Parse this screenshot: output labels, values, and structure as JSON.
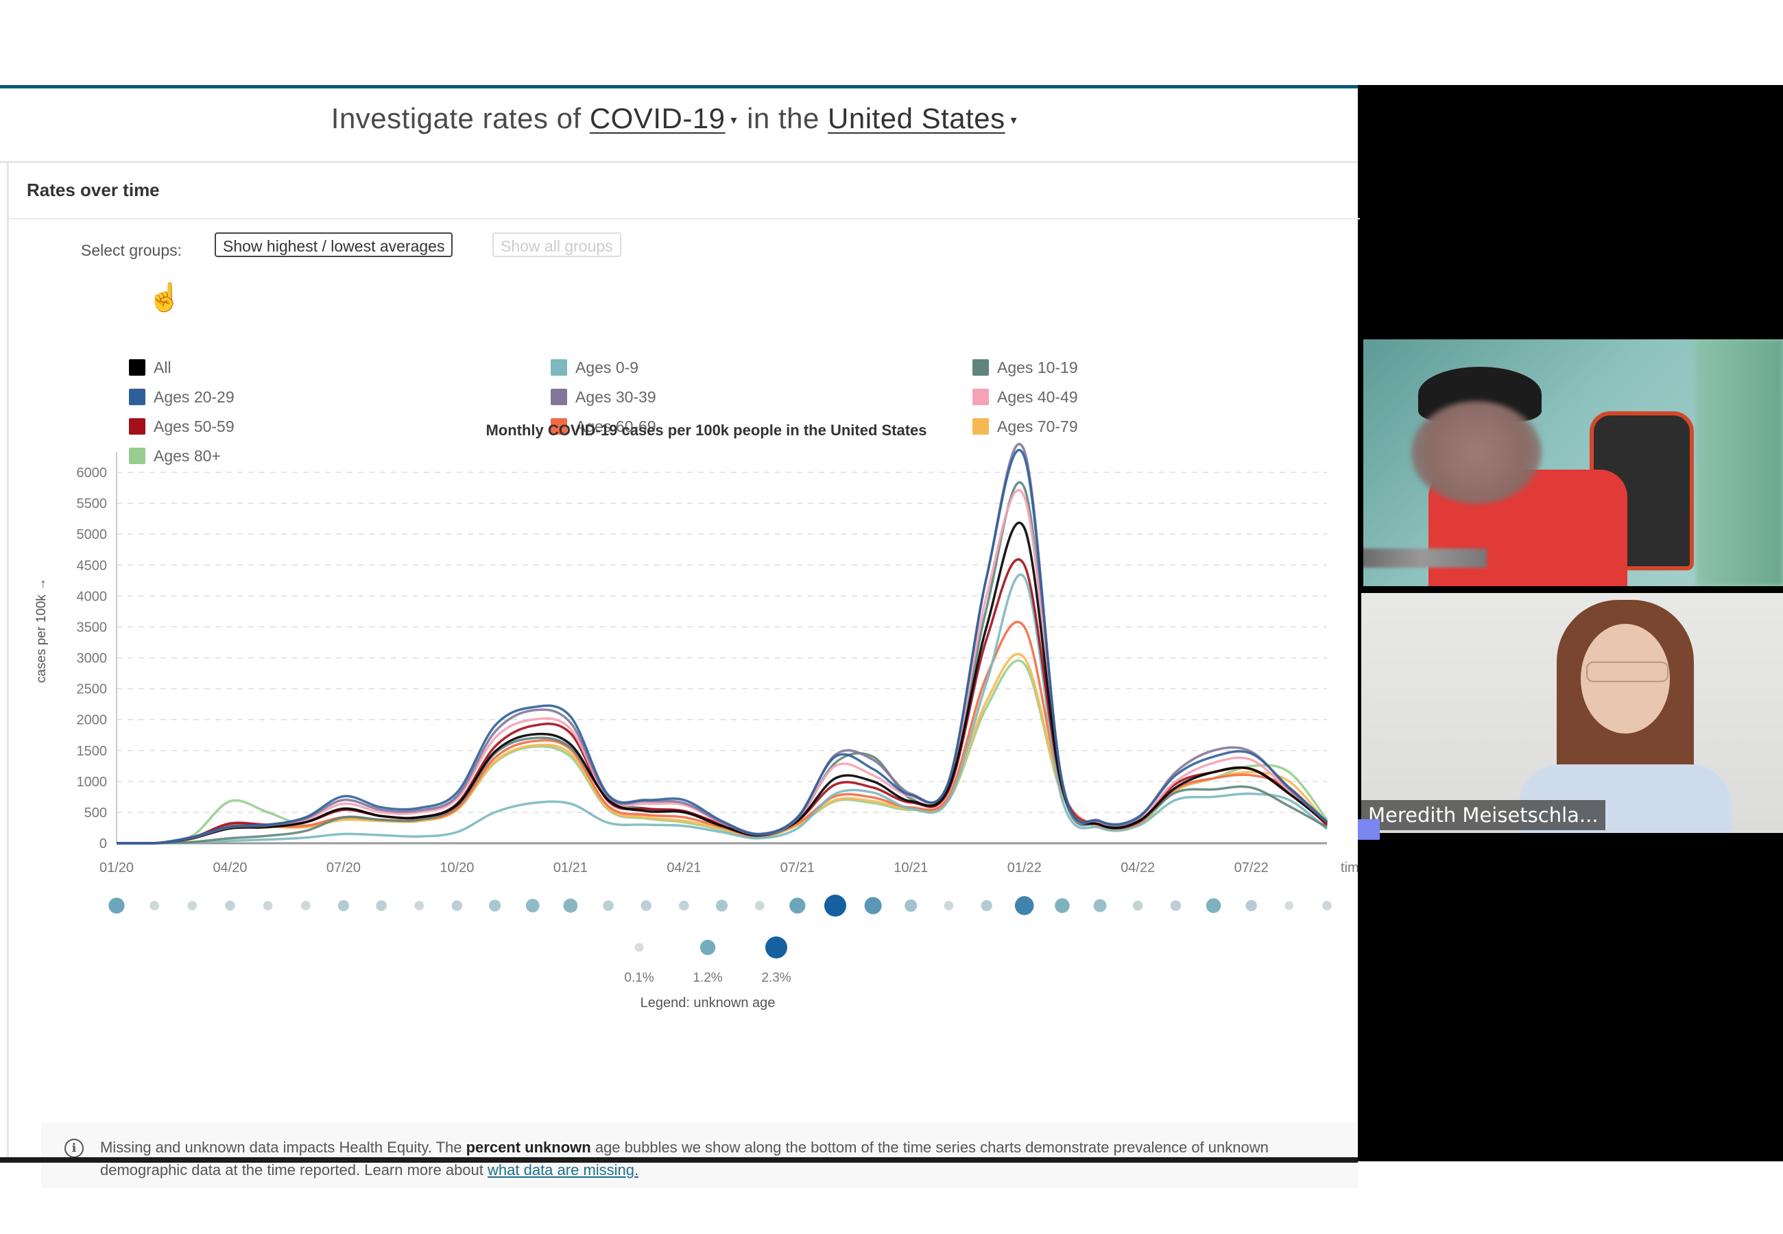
{
  "header": {
    "prefix": "Investigate rates of",
    "condition": "COVID-19",
    "middle": "in the",
    "location": "United States",
    "caret": "▾"
  },
  "card": {
    "title": "Rates over time",
    "select_groups_label": "Select groups:",
    "buttons": {
      "highest_lowest": "Show highest / lowest averages",
      "show_all": "Show all groups"
    }
  },
  "legend": [
    {
      "label": "All",
      "color": "#000000"
    },
    {
      "label": "Ages 0-9",
      "color": "#7cb8bd"
    },
    {
      "label": "Ages 10-19",
      "color": "#5f857c"
    },
    {
      "label": "Ages 20-29",
      "color": "#2f5f9a"
    },
    {
      "label": "Ages 30-39",
      "color": "#83769a"
    },
    {
      "label": "Ages 40-49",
      "color": "#f4a2b6"
    },
    {
      "label": "Ages 50-59",
      "color": "#a3101c"
    },
    {
      "label": "Ages 60-69",
      "color": "#f36b45"
    },
    {
      "label": "Ages 70-79",
      "color": "#f6b951"
    },
    {
      "label": "Ages 80+",
      "color": "#98cd8f"
    }
  ],
  "chart_data": {
    "type": "line",
    "title": "Monthly COVID-19 cases per 100k people in the United States",
    "xlabel": "time",
    "ylabel": "cases per 100k",
    "ylim": [
      0,
      6000
    ],
    "yticks": [
      0,
      500,
      1000,
      1500,
      2000,
      2500,
      3000,
      3500,
      4000,
      4500,
      5000,
      5500,
      6000
    ],
    "grid": true,
    "x": [
      "01/20",
      "02/20",
      "03/20",
      "04/20",
      "05/20",
      "06/20",
      "07/20",
      "08/20",
      "09/20",
      "10/20",
      "11/20",
      "12/20",
      "01/21",
      "02/21",
      "03/21",
      "04/21",
      "05/21",
      "06/21",
      "07/21",
      "08/21",
      "09/21",
      "10/21",
      "11/21",
      "12/21",
      "01/22",
      "02/22",
      "03/22",
      "04/22",
      "05/22",
      "06/22",
      "07/22",
      "08/22",
      "09/22"
    ],
    "xtick_labels": [
      "01/20",
      "04/20",
      "07/20",
      "10/20",
      "01/21",
      "04/21",
      "07/21",
      "10/21",
      "01/22",
      "04/22",
      "07/22"
    ],
    "series": [
      {
        "name": "All",
        "values": [
          0,
          0,
          80,
          240,
          260,
          340,
          560,
          440,
          420,
          620,
          1480,
          1760,
          1600,
          700,
          520,
          500,
          280,
          130,
          360,
          1050,
          1000,
          680,
          900,
          3500,
          5100,
          900,
          300,
          350,
          900,
          1150,
          1200,
          800,
          330
        ]
      },
      {
        "name": "Ages 0-9",
        "values": [
          0,
          0,
          10,
          40,
          60,
          90,
          150,
          130,
          110,
          180,
          500,
          650,
          640,
          330,
          300,
          280,
          180,
          80,
          240,
          800,
          820,
          560,
          700,
          2600,
          4300,
          700,
          250,
          280,
          700,
          750,
          800,
          700,
          230
        ]
      },
      {
        "name": "Ages 10-19",
        "values": [
          0,
          0,
          20,
          80,
          120,
          200,
          420,
          380,
          380,
          600,
          1450,
          1700,
          1550,
          720,
          560,
          520,
          300,
          120,
          380,
          1300,
          1400,
          720,
          900,
          3800,
          5750,
          900,
          300,
          340,
          820,
          870,
          900,
          600,
          260
        ]
      },
      {
        "name": "Ages 20-29",
        "values": [
          0,
          0,
          100,
          270,
          300,
          420,
          760,
          580,
          570,
          820,
          1900,
          2200,
          2050,
          780,
          700,
          700,
          360,
          150,
          420,
          1400,
          1200,
          780,
          1000,
          4300,
          6250,
          1000,
          360,
          420,
          1100,
          1400,
          1450,
          900,
          350
        ]
      },
      {
        "name": "Ages 30-39",
        "values": [
          0,
          0,
          90,
          260,
          290,
          400,
          700,
          540,
          530,
          760,
          1800,
          2150,
          1950,
          750,
          680,
          650,
          340,
          140,
          400,
          1430,
          1350,
          800,
          1000,
          4300,
          6350,
          980,
          350,
          400,
          1150,
          1500,
          1480,
          880,
          340
        ]
      },
      {
        "name": "Ages 40-49",
        "values": [
          0,
          0,
          90,
          260,
          290,
          380,
          640,
          500,
          500,
          720,
          1700,
          2000,
          1850,
          720,
          640,
          620,
          330,
          140,
          390,
          1250,
          1100,
          760,
          950,
          4000,
          5600,
          950,
          340,
          390,
          1000,
          1300,
          1350,
          850,
          330
        ]
      },
      {
        "name": "Ages 50-59",
        "values": [
          0,
          0,
          90,
          320,
          300,
          340,
          540,
          440,
          420,
          640,
          1560,
          1900,
          1780,
          680,
          560,
          520,
          300,
          130,
          360,
          950,
          900,
          660,
          860,
          3300,
          4500,
          900,
          300,
          340,
          960,
          1150,
          1200,
          820,
          300
        ]
      },
      {
        "name": "Ages 60-69",
        "values": [
          0,
          0,
          80,
          300,
          280,
          280,
          420,
          380,
          380,
          560,
          1380,
          1650,
          1520,
          600,
          460,
          420,
          260,
          110,
          320,
          760,
          740,
          580,
          760,
          2700,
          3500,
          850,
          280,
          320,
          880,
          1050,
          1100,
          900,
          280
        ]
      },
      {
        "name": "Ages 70-79",
        "values": [
          0,
          0,
          70,
          300,
          270,
          260,
          380,
          360,
          360,
          540,
          1320,
          1580,
          1450,
          560,
          420,
          360,
          240,
          100,
          300,
          700,
          680,
          560,
          720,
          2300,
          3000,
          800,
          260,
          300,
          860,
          1050,
          1150,
          1000,
          320
        ]
      },
      {
        "name": "Ages 80+",
        "values": [
          0,
          0,
          120,
          680,
          500,
          290,
          380,
          360,
          360,
          540,
          1300,
          1560,
          1400,
          540,
          400,
          340,
          220,
          100,
          290,
          680,
          650,
          540,
          700,
          2200,
          2900,
          780,
          250,
          290,
          850,
          1050,
          1250,
          1150,
          380
        ]
      }
    ],
    "unknown_bubbles": {
      "label": "Legend: unknown age",
      "legend_values_pct": [
        0.1,
        1.2,
        2.3
      ],
      "legend_labels": [
        "0.1%",
        "1.2%",
        "2.3%"
      ],
      "values_pct": [
        1.3,
        0.2,
        0.2,
        0.3,
        0.2,
        0.2,
        0.5,
        0.4,
        0.2,
        0.4,
        0.6,
        0.9,
        1.0,
        0.4,
        0.4,
        0.3,
        0.6,
        0.2,
        1.3,
        2.3,
        1.5,
        0.7,
        0.2,
        0.5,
        1.8,
        1.1,
        0.8,
        0.3,
        0.4,
        1.1,
        0.5,
        0.1,
        0.2
      ]
    }
  },
  "note": {
    "text_before": "Missing and unknown data impacts Health Equity. The ",
    "bold": "percent unknown",
    "text_after": " age bubbles we show along the bottom of the time series charts demonstrate prevalence of unknown demographic data at the time reported. Learn more about ",
    "link": "what data are missing."
  },
  "video": {
    "participant_2_name": "Meredith Meisetschla..."
  }
}
